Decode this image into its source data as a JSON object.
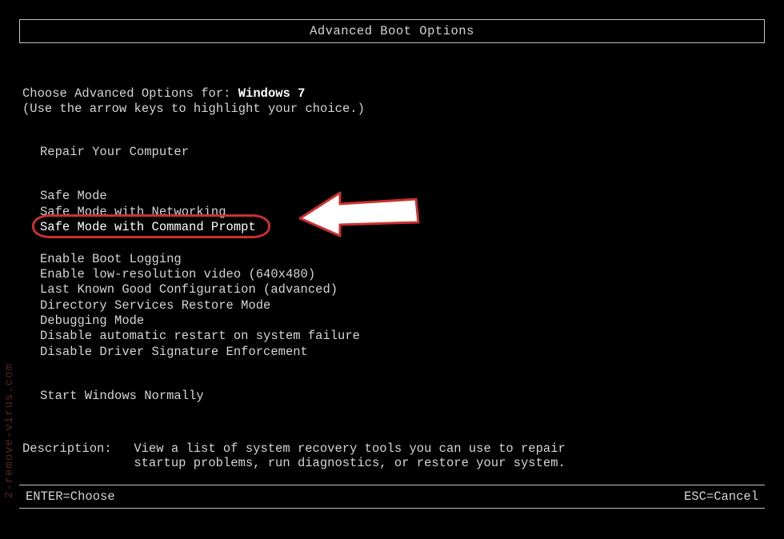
{
  "title": "Advanced Boot Options",
  "prompt": {
    "label": "Choose Advanced Options for: ",
    "os": "Windows 7"
  },
  "hint": "(Use the arrow keys to highlight your choice.)",
  "groups": {
    "repair": "Repair Your Computer",
    "safe": [
      "Safe Mode",
      "Safe Mode with Networking",
      "Safe Mode with Command Prompt"
    ],
    "options": [
      "Enable Boot Logging",
      "Enable low-resolution video (640x480)",
      "Last Known Good Configuration (advanced)",
      "Directory Services Restore Mode",
      "Debugging Mode",
      "Disable automatic restart on system failure",
      "Disable Driver Signature Enforcement"
    ],
    "normal": "Start Windows Normally"
  },
  "selected": "Safe Mode with Command Prompt",
  "description": {
    "label": "Description:",
    "text": "View a list of system recovery tools you can use to repair startup problems, run diagnostics, or restore your system."
  },
  "footer": {
    "enter": "ENTER=Choose",
    "esc": "ESC=Cancel"
  },
  "watermark": "2-remove-virus.com"
}
